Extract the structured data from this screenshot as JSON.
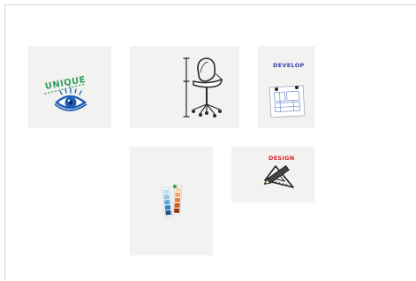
{
  "gallery": {
    "tiles": [
      {
        "label": "UNIQUE",
        "icon": "eye-icon",
        "label_color": "#2e9e5b",
        "icon_color": "#1f5fb8"
      },
      {
        "icon": "office-chair-icon"
      },
      {
        "label": "DEVELOP",
        "icon": "blueprint-icon",
        "label_color": "#3a3fb5"
      },
      {
        "icon": "color-swatch-fan-icon"
      },
      {
        "label": "DESIGN",
        "icon": "pencil-ruler-icon",
        "label_color": "#d6262b"
      }
    ]
  }
}
